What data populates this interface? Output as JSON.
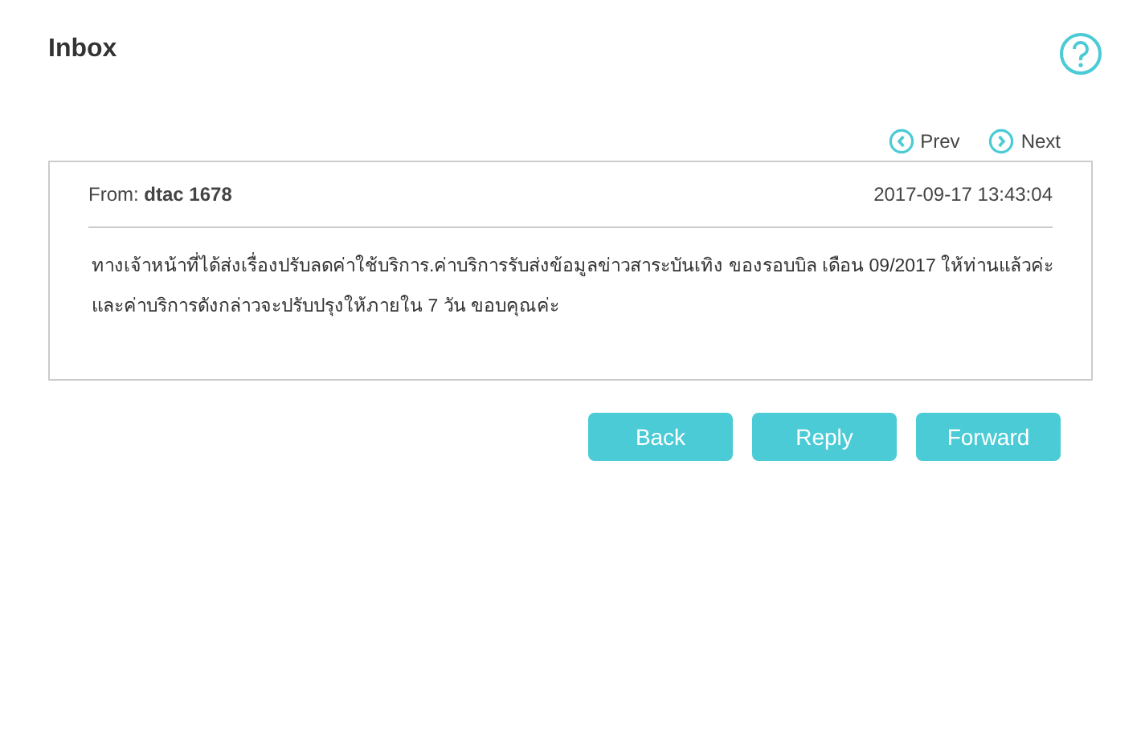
{
  "title": "Inbox",
  "pager": [
    {
      "kind": "prev",
      "label": "Prev"
    },
    {
      "kind": "next",
      "label": "Next"
    }
  ],
  "message": {
    "from_label": "From:",
    "sender": "dtac 1678",
    "date": "2017-09-17 13:43:04",
    "body_lines": [
      "ทางเจ้าหน้าที่ได้ส่งเรื่องปรับลดค่าใช้บริการ.ค่าบริการรับส่งข้อมูลข่าวสาระบันเทิง ของรอบบิล เดือน 09/2017 ให้ท่านแล้วค่ะ",
      "และค่าบริการดังกล่าวจะปรับปรุงให้ภายใน 7 วัน ขอบคุณค่ะ"
    ]
  },
  "buttons": [
    "Back",
    "Reply",
    "Forward"
  ]
}
